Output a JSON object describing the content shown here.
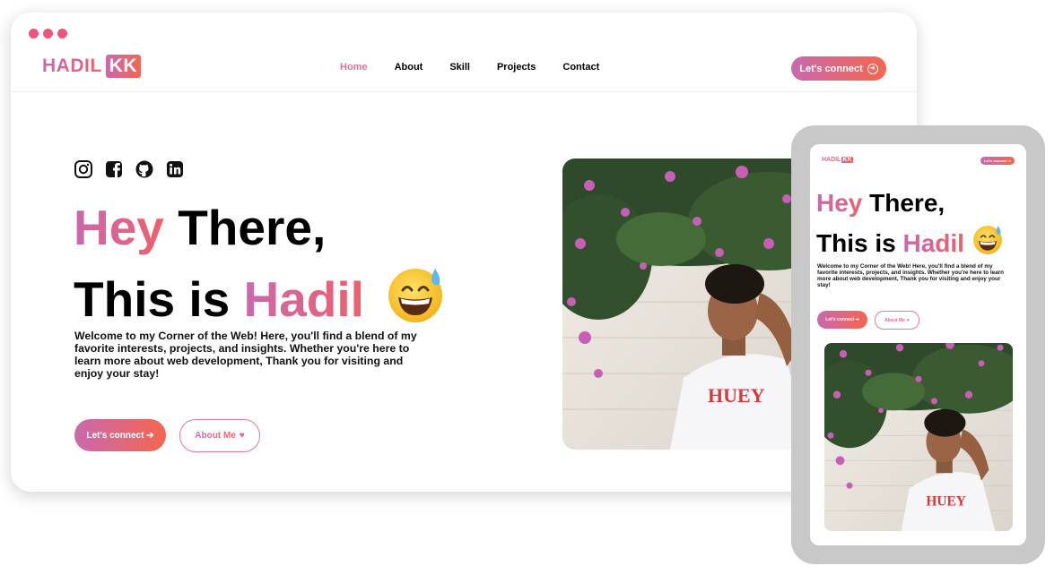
{
  "colors": {
    "accent_start": "#c969ad",
    "accent_end": "#f05f6a",
    "nav_active": "#e07394",
    "dots": "#e9577a"
  },
  "desktop": {
    "logo": {
      "name": "HADIL",
      "badge": "KK"
    },
    "nav": [
      {
        "label": "Home",
        "active": true
      },
      {
        "label": "About",
        "active": false
      },
      {
        "label": "Skill",
        "active": false
      },
      {
        "label": "Projects",
        "active": false
      },
      {
        "label": "Contact",
        "active": false
      }
    ],
    "connect_button": {
      "label": "Let's connect",
      "icon": "arrow-circle-icon"
    },
    "socials": [
      "instagram-icon",
      "facebook-icon",
      "github-icon",
      "linkedin-icon"
    ],
    "headline": {
      "word1": "Hey",
      "word2": "There,",
      "word3": "This is",
      "word4": "Hadil",
      "emoji": "grinning-sweat-emoji"
    },
    "description": "Welcome to my Corner of the Web! Here, you'll find a blend of my favorite interests, projects, and insights. Whether you're here to learn more about web development, Thank you for visiting and enjoy your stay!",
    "cta_connect": {
      "label": "Let's connect",
      "icon": "arrow-right-icon"
    },
    "cta_about": {
      "label": "About Me",
      "icon": "heart-icon"
    }
  },
  "tablet": {
    "logo": {
      "name": "HADIL",
      "badge": "KK"
    },
    "connect_button": {
      "label": "Let's connect"
    },
    "headline": {
      "word1": "Hey",
      "word2": "There,",
      "word3": "This is",
      "word4": "Hadil"
    },
    "description": "Welcome to my Corner of the Web! Here, you'll find a blend of my favorite interests, projects, and insights. Whether you're here to learn more about web development, Thank you for visiting and enjoy your stay!",
    "cta_connect": {
      "label": "Let's connect"
    },
    "cta_about": {
      "label": "About Me"
    }
  }
}
